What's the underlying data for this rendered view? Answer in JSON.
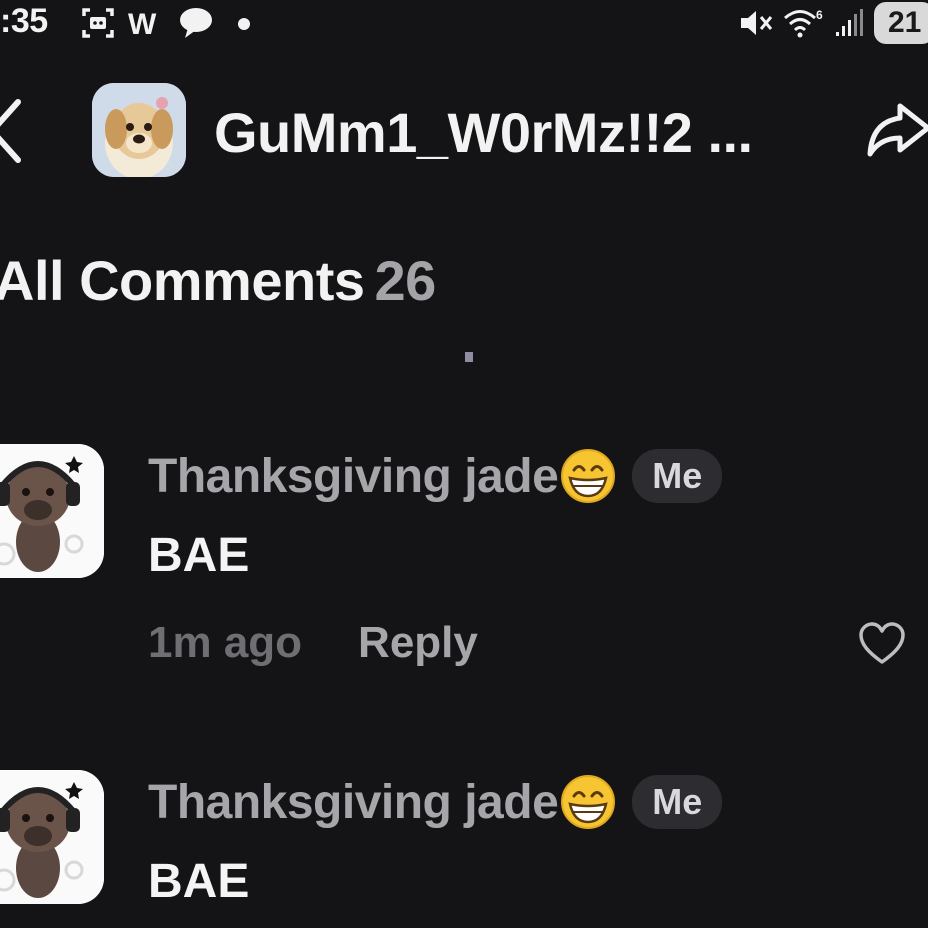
{
  "status_bar": {
    "time": ":35",
    "letter_indicator": "W",
    "battery": "21",
    "icons": [
      "screenshot-icon",
      "message-bubble-icon",
      "notification-dot-icon",
      "mute-icon",
      "wifi-icon",
      "signal-icon",
      "battery-icon"
    ]
  },
  "header": {
    "title": "GuMm1_W0rMz!!2 ...",
    "icons": [
      "back-arrow-icon",
      "share-arrow-icon"
    ]
  },
  "section": {
    "title": "All Comments",
    "count": "26"
  },
  "comments": [
    {
      "author": "Thanksgiving jade",
      "badge": "Me",
      "text": "BAE",
      "time": "1m ago",
      "reply_label": "Reply"
    },
    {
      "author": "Thanksgiving jade",
      "badge": "Me",
      "text": "BAE"
    }
  ],
  "colors": {
    "background": "#141316",
    "author": "#a6a5aa",
    "badge_background": "#2d2c31",
    "time": "#6f6e73"
  }
}
